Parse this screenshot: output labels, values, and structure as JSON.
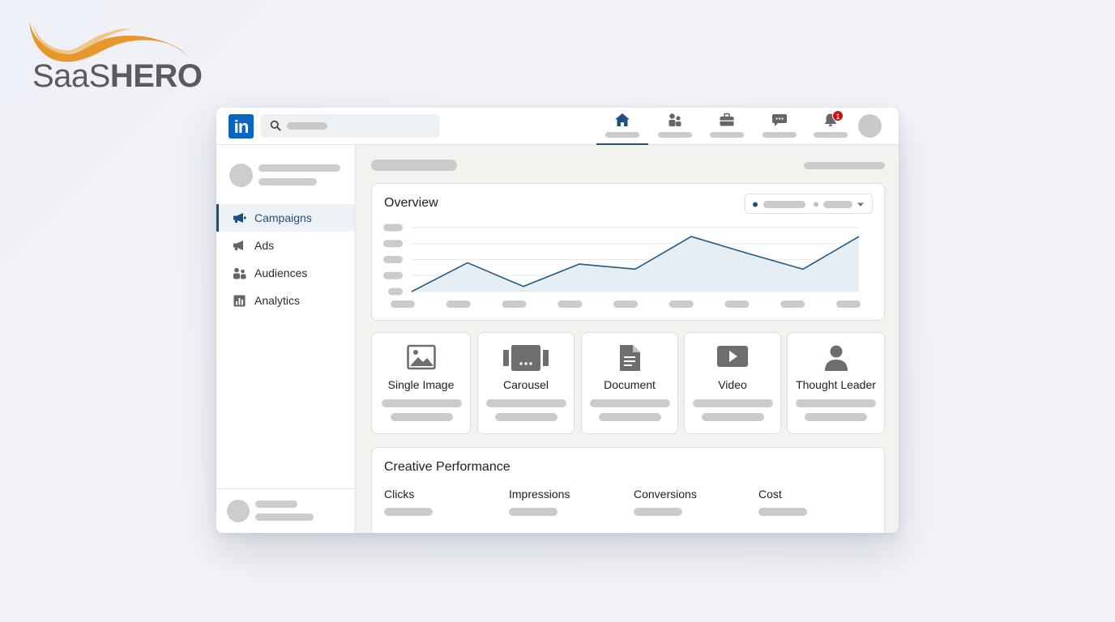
{
  "brand": {
    "name_light": "SaaS",
    "name_bold": "HERO",
    "swoosh_color": "#e8962e"
  },
  "topbar": {
    "logo_text": "in",
    "logo_color": "#0a66c2",
    "search_icon": "search-icon",
    "nav_icons": [
      "home-icon",
      "people-icon",
      "briefcase-icon",
      "message-icon",
      "bell-icon"
    ],
    "active_nav": "home",
    "notification_count": "1"
  },
  "sidebar": {
    "items": [
      {
        "label": "Campaigns",
        "icon": "megaphone-icon",
        "active": true
      },
      {
        "label": "Ads",
        "icon": "megaphone-outline-icon",
        "active": false
      },
      {
        "label": "Audiences",
        "icon": "people-icon",
        "active": false
      },
      {
        "label": "Analytics",
        "icon": "bar-chart-icon",
        "active": false
      }
    ],
    "accent_color": "#1d4f82"
  },
  "overview": {
    "title": "Overview"
  },
  "chart_data": {
    "type": "area",
    "title": "Overview",
    "xlabel": "",
    "ylabel": "",
    "series": [
      {
        "values": [
          0.0,
          0.45,
          0.08,
          0.43,
          0.35,
          0.86,
          0.6,
          0.35,
          0.86
        ]
      }
    ],
    "ylim": [
      0,
      1
    ],
    "grid": true,
    "line_color": "#1d5a86"
  },
  "formats": [
    {
      "label": "Single Image",
      "icon": "image-icon"
    },
    {
      "label": "Carousel",
      "icon": "carousel-icon"
    },
    {
      "label": "Document",
      "icon": "document-icon"
    },
    {
      "label": "Video",
      "icon": "video-play-icon"
    },
    {
      "label": "Thought Leader",
      "icon": "person-icon"
    }
  ],
  "performance": {
    "title": "Creative Performance",
    "metrics": [
      "Clicks",
      "Impressions",
      "Conversions",
      "Cost"
    ]
  }
}
